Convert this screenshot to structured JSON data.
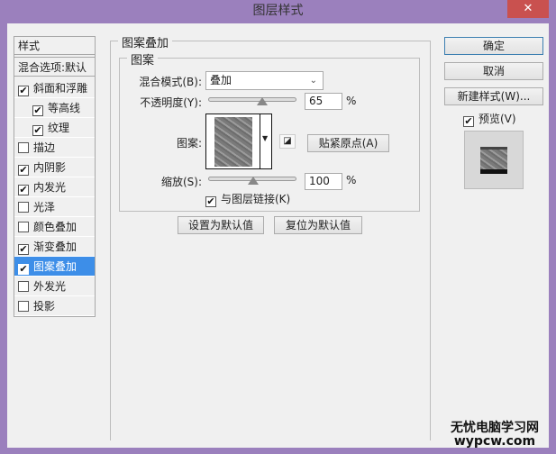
{
  "window": {
    "title": "图层样式",
    "close": "✕"
  },
  "sidebar": {
    "header": "样式",
    "blend_options": "混合选项:默认",
    "items": [
      {
        "label": "斜面和浮雕",
        "checked": true,
        "indent": false
      },
      {
        "label": "等高线",
        "checked": true,
        "indent": true
      },
      {
        "label": "纹理",
        "checked": true,
        "indent": true
      },
      {
        "label": "描边",
        "checked": false,
        "indent": false
      },
      {
        "label": "内阴影",
        "checked": true,
        "indent": false
      },
      {
        "label": "内发光",
        "checked": true,
        "indent": false
      },
      {
        "label": "光泽",
        "checked": false,
        "indent": false
      },
      {
        "label": "颜色叠加",
        "checked": false,
        "indent": false
      },
      {
        "label": "渐变叠加",
        "checked": true,
        "indent": false
      },
      {
        "label": "图案叠加",
        "checked": true,
        "indent": false,
        "selected": true
      },
      {
        "label": "外发光",
        "checked": false,
        "indent": false
      },
      {
        "label": "投影",
        "checked": false,
        "indent": false
      }
    ]
  },
  "main": {
    "group_title": "图案叠加",
    "sub_title": "图案",
    "blend_mode_label": "混合模式(B):",
    "blend_mode": "叠加",
    "opacity_label": "不透明度(Y):",
    "opacity": "65",
    "percent": "%",
    "opacity_value": 65,
    "pattern_label": "图案:",
    "snap_button": "贴紧原点(A)",
    "scale_label": "缩放(S):",
    "scale": "100",
    "scale_slider_value": 100,
    "link_label": "与图层链接(K)",
    "link_checked": true,
    "set_default": "设置为默认值",
    "reset_default": "复位为默认值"
  },
  "right": {
    "ok": "确定",
    "cancel": "取消",
    "new_style": "新建样式(W)...",
    "preview_label": "预览(V)",
    "preview_checked": true
  },
  "watermark": {
    "line1": "无忧电脑学习网",
    "line2": "wypcw.com"
  }
}
